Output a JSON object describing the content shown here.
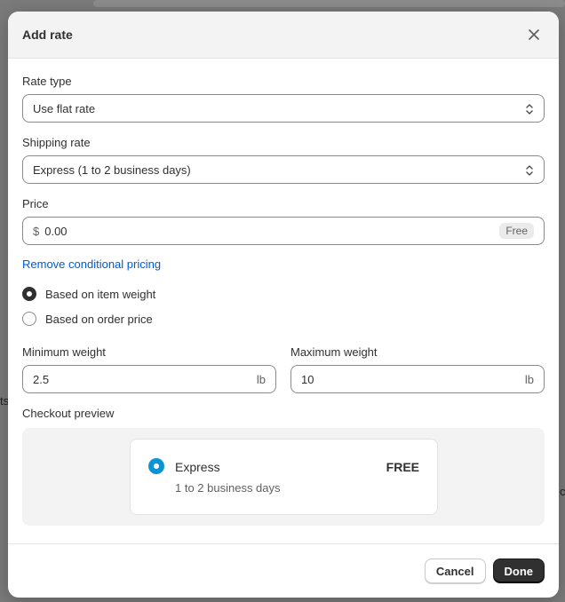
{
  "background": {
    "snippet_left": "ts",
    "snippet_right": "c"
  },
  "modal": {
    "title": "Add rate",
    "rate_type": {
      "label": "Rate type",
      "value": "Use flat rate"
    },
    "shipping_rate": {
      "label": "Shipping rate",
      "value": "Express (1 to 2 business days)"
    },
    "price": {
      "label": "Price",
      "prefix": "$",
      "value": "0.00",
      "badge": "Free"
    },
    "remove_link": "Remove conditional pricing",
    "conditions": [
      {
        "label": "Based on item weight",
        "checked": true
      },
      {
        "label": "Based on order price",
        "checked": false
      }
    ],
    "min_weight": {
      "label": "Minimum weight",
      "value": "2.5",
      "unit": "lb"
    },
    "max_weight": {
      "label": "Maximum weight",
      "value": "10",
      "unit": "lb"
    },
    "preview": {
      "label": "Checkout preview",
      "name": "Express",
      "price": "FREE",
      "description": "1 to 2 business days"
    },
    "footer": {
      "cancel": "Cancel",
      "done": "Done"
    }
  },
  "colors": {
    "primary_button": "#303030",
    "link": "#005bd3",
    "preview_radio": "#0b94d3"
  }
}
